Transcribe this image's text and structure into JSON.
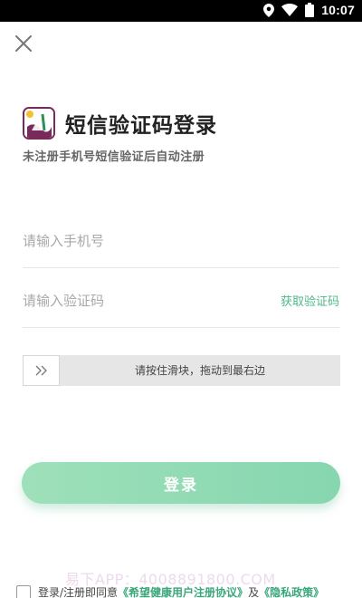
{
  "status_bar": {
    "time": "10:07",
    "icons": [
      "location-icon",
      "wifi-icon",
      "battery-icon"
    ]
  },
  "header": {
    "close_icon": "close-icon"
  },
  "brand": {
    "title": "短信验证码登录",
    "subtitle": "未注册手机号短信验证后自动注册"
  },
  "form": {
    "phone_placeholder": "请输入手机号",
    "phone_value": "",
    "code_placeholder": "请输入验证码",
    "code_value": "",
    "get_code_label": "获取验证码"
  },
  "slider": {
    "hint": "请按住滑块，拖动到最右边",
    "handle_icon": "double-chevron-right-icon",
    "progress": 0
  },
  "login_button": {
    "label": "登录"
  },
  "agreement": {
    "prefix": "登录/注册即同意",
    "user_agreement": "《希望健康用户注册协议》",
    "conjunction": "及",
    "privacy_policy": "《隐私政策》",
    "checked": false
  },
  "watermark": "易下APP：4008891800.COM",
  "colors": {
    "accent": "#4fb78a",
    "button": "#92dbb5",
    "status_bar": "#000000"
  }
}
